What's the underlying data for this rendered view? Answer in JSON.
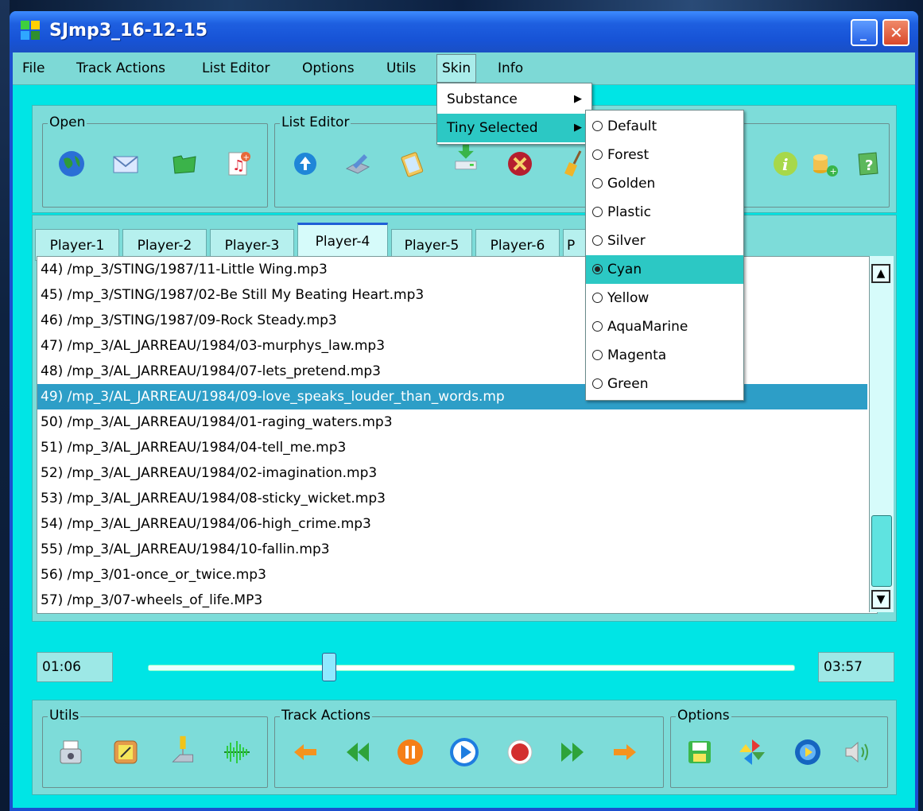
{
  "window": {
    "title": "SJmp3_16-12-15",
    "minimize_glyph": "_",
    "close_glyph": "✕"
  },
  "menu": {
    "items": [
      "File",
      "Track Actions",
      "List Editor",
      "Options",
      "Utils",
      "Skin",
      "Info"
    ],
    "active": "Skin"
  },
  "toolbar": {
    "open_label": "Open",
    "list_editor_label": "List Editor",
    "open_icons": [
      "globe-icon",
      "mail-icon",
      "folder-icon",
      "add-music-icon"
    ],
    "list_editor_icons": [
      "upload-icon",
      "edit-icon",
      "clipboard-icon",
      "download-icon",
      "delete-icon",
      "broom-icon"
    ],
    "info_icons": [
      "info-icon",
      "coins-icon",
      "help-book-icon"
    ]
  },
  "tabs": [
    "Player-1",
    "Player-2",
    "Player-3",
    "Player-4",
    "Player-5",
    "Player-6",
    "P"
  ],
  "active_tab": "Player-4",
  "playlist": [
    "44) /mp_3/STING/1987/11-Little Wing.mp3",
    "45) /mp_3/STING/1987/02-Be Still My Beating Heart.mp3",
    "46) /mp_3/STING/1987/09-Rock Steady.mp3",
    "47) /mp_3/AL_JARREAU/1984/03-murphys_law.mp3",
    "48) /mp_3/AL_JARREAU/1984/07-lets_pretend.mp3",
    "49) /mp_3/AL_JARREAU/1984/09-love_speaks_louder_than_words.mp",
    "50) /mp_3/AL_JARREAU/1984/01-raging_waters.mp3",
    "51) /mp_3/AL_JARREAU/1984/04-tell_me.mp3",
    "52) /mp_3/AL_JARREAU/1984/02-imagination.mp3",
    "53) /mp_3/AL_JARREAU/1984/08-sticky_wicket.mp3",
    "54) /mp_3/AL_JARREAU/1984/06-high_crime.mp3",
    "55) /mp_3/AL_JARREAU/1984/10-fallin.mp3",
    "56) /mp_3/01-once_or_twice.mp3",
    "57) /mp_3/07-wheels_of_life.MP3"
  ],
  "selected_row": "49) /mp_3/AL_JARREAU/1984/09-love_speaks_louder_than_words.mp",
  "playback": {
    "elapsed": "01:06",
    "total": "03:57",
    "progress_fraction": 0.28
  },
  "skin_menu": {
    "items": [
      "Substance",
      "Tiny Selected"
    ],
    "highlighted": "Tiny Selected",
    "submenu_arrow": "▶"
  },
  "tiny_selected_menu": {
    "options": [
      "Default",
      "Forest",
      "Golden",
      "Plastic",
      "Silver",
      "Cyan",
      "Yellow",
      "AquaMarine",
      "Magenta",
      "Green"
    ],
    "selected": "Cyan"
  },
  "bottom": {
    "utils_label": "Utils",
    "track_actions_label": "Track Actions",
    "options_label": "Options",
    "utils_icons": [
      "printer-icon",
      "notepad-icon",
      "tool-icon",
      "waveform-icon"
    ],
    "track_icons": [
      "previous-arrow-icon",
      "rewind-icon",
      "pause-icon",
      "play-icon",
      "record-icon",
      "fast-forward-icon",
      "next-arrow-icon"
    ],
    "options_icons": [
      "save-icon",
      "pinwheel-icon",
      "media-icon",
      "volume-icon"
    ]
  },
  "scroll": {
    "up_glyph": "▲",
    "down_glyph": "▼"
  }
}
